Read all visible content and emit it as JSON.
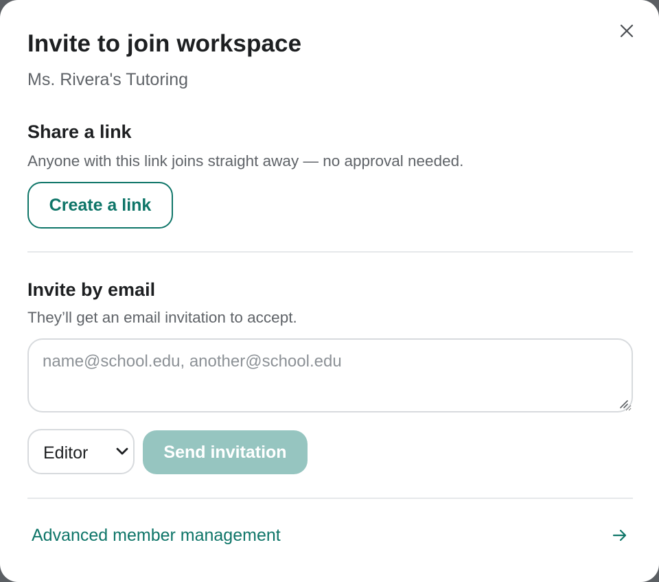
{
  "dialog": {
    "title": "Invite to join workspace",
    "subtitle": "Ms. Rivera's Tutoring",
    "close_icon": "close-icon"
  },
  "share_link": {
    "heading": "Share a link",
    "description": "Anyone with this link joins straight away — no approval needed.",
    "button_label": "Create a link"
  },
  "invite_email": {
    "heading": "Invite by email",
    "description": "They’ll get an email invitation to accept.",
    "input_value": "",
    "input_placeholder": "name@school.edu, another@school.edu",
    "role_selected": "Editor",
    "send_label": "Send invitation",
    "send_enabled": false
  },
  "footer": {
    "link_label": "Advanced member management",
    "arrow_icon": "arrow-right-icon"
  },
  "colors": {
    "accent": "#0e7568",
    "accent_disabled": "#96c5c0",
    "heading_text": "#1d1f21",
    "muted_text": "#5f6368",
    "border": "#d7dadd",
    "divider": "#e6e8ea"
  }
}
